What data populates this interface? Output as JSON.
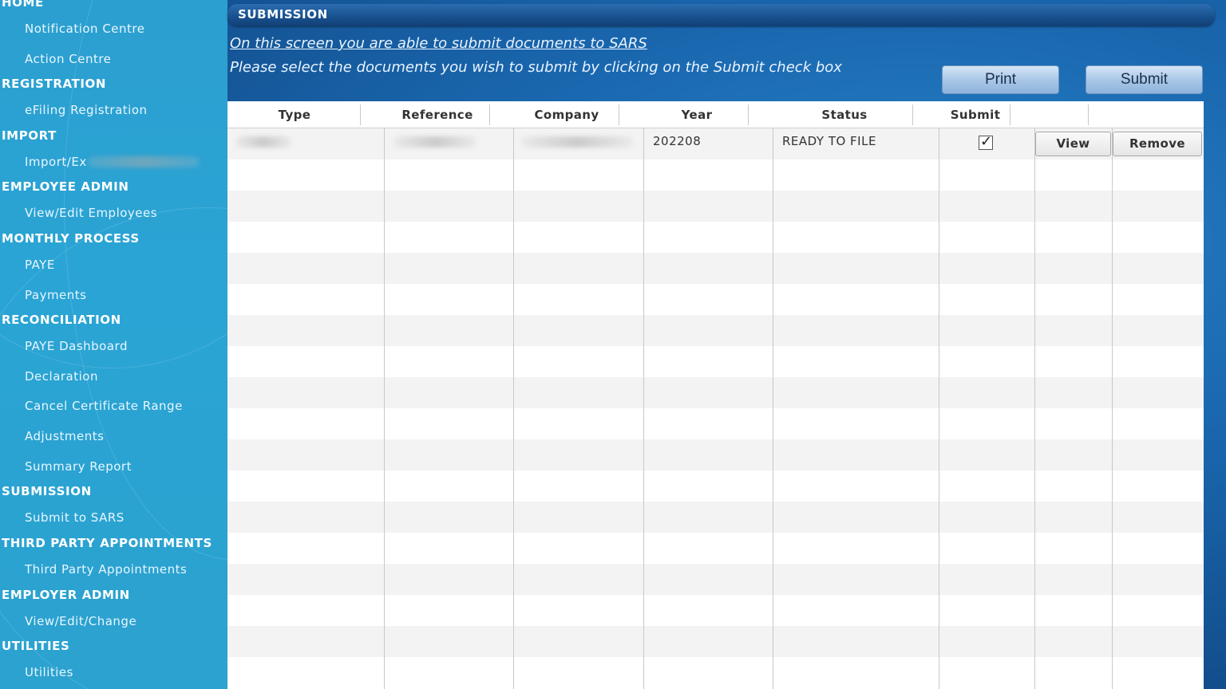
{
  "sidebar": {
    "sections": [
      {
        "label": "HOME",
        "items": [
          "Notification Centre",
          "Action Centre"
        ]
      },
      {
        "label": "REGISTRATION",
        "items": [
          "eFiling Registration"
        ]
      },
      {
        "label": "IMPORT",
        "items": [
          "Import/Ex"
        ]
      },
      {
        "label": "EMPLOYEE ADMIN",
        "items": [
          "View/Edit Employees"
        ]
      },
      {
        "label": "MONTHLY PROCESS",
        "items": [
          "PAYE",
          "Payments"
        ]
      },
      {
        "label": "RECONCILIATION",
        "items": [
          "PAYE Dashboard",
          "Declaration",
          "Cancel Certificate Range",
          "Adjustments",
          "Summary Report"
        ]
      },
      {
        "label": "SUBMISSION",
        "items": [
          "Submit to SARS"
        ]
      },
      {
        "label": "THIRD PARTY APPOINTMENTS",
        "items": [
          "Third Party Appointments"
        ]
      },
      {
        "label": "EMPLOYER ADMIN",
        "items": [
          "View/Edit/Change"
        ]
      },
      {
        "label": "UTILITIES",
        "items": [
          "Utilities"
        ]
      }
    ]
  },
  "header": {
    "title": "SUBMISSION"
  },
  "instructions": {
    "link": "On this screen you are able to submit documents to SARS",
    "text": "Please select the documents you wish to submit by clicking on the Submit check box"
  },
  "buttons": {
    "print": "Print",
    "submit": "Submit"
  },
  "table": {
    "columns": [
      "Type",
      "Reference",
      "Company",
      "Year",
      "Status",
      "Submit"
    ],
    "rows": [
      {
        "year": "202208",
        "status": "READY TO FILE",
        "submit_checked": true,
        "view": "View",
        "remove": "Remove"
      }
    ]
  },
  "check_glyph": "✓"
}
